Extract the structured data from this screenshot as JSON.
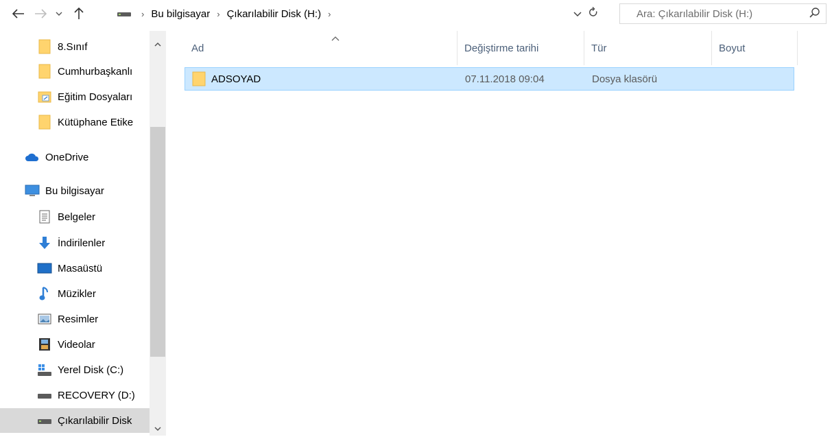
{
  "nav": {
    "back_icon": "arrow-left-icon",
    "forward_icon": "arrow-right-icon",
    "recent_icon": "chevron-down-icon",
    "up_icon": "arrow-up-icon"
  },
  "address": {
    "drive_icon": "removable-drive-icon",
    "crumbs": [
      "Bu bilgisayar",
      "Çıkarılabilir Disk (H:)"
    ]
  },
  "search": {
    "placeholder": "Ara: Çıkarılabilir Disk (H:)"
  },
  "sidebar": {
    "items": [
      {
        "label": "8.Sınıf",
        "icon": "folder-icon"
      },
      {
        "label": "Cumhurbaşkanlı",
        "icon": "folder-icon"
      },
      {
        "label": "Eğitim Dosyaları",
        "icon": "shortcut-folder-icon"
      },
      {
        "label": "Kütüphane Etike",
        "icon": "folder-icon"
      },
      {
        "label": "OneDrive",
        "icon": "onedrive-icon"
      },
      {
        "label": "Bu bilgisayar",
        "icon": "computer-icon"
      },
      {
        "label": "Belgeler",
        "icon": "documents-icon"
      },
      {
        "label": "İndirilenler",
        "icon": "downloads-icon"
      },
      {
        "label": "Masaüstü",
        "icon": "desktop-icon"
      },
      {
        "label": "Müzikler",
        "icon": "music-icon"
      },
      {
        "label": "Resimler",
        "icon": "pictures-icon"
      },
      {
        "label": "Videolar",
        "icon": "videos-icon"
      },
      {
        "label": "Yerel Disk (C:)",
        "icon": "local-disk-icon"
      },
      {
        "label": "RECOVERY (D:)",
        "icon": "drive-icon"
      },
      {
        "label": "Çıkarılabilir Disk",
        "icon": "removable-drive-icon",
        "selected": true
      }
    ]
  },
  "columns": {
    "name": "Ad",
    "modified": "Değiştirme tarihi",
    "type": "Tür",
    "size": "Boyut"
  },
  "files": [
    {
      "name": "ADSOYAD",
      "modified": "07.11.2018 09:04",
      "type": "Dosya klasörü",
      "size": ""
    }
  ],
  "colors": {
    "selection_bg": "#cce8ff",
    "selection_border": "#99d1ff",
    "header_text": "#4c607a",
    "folder_yellow": "#ffd46e"
  }
}
